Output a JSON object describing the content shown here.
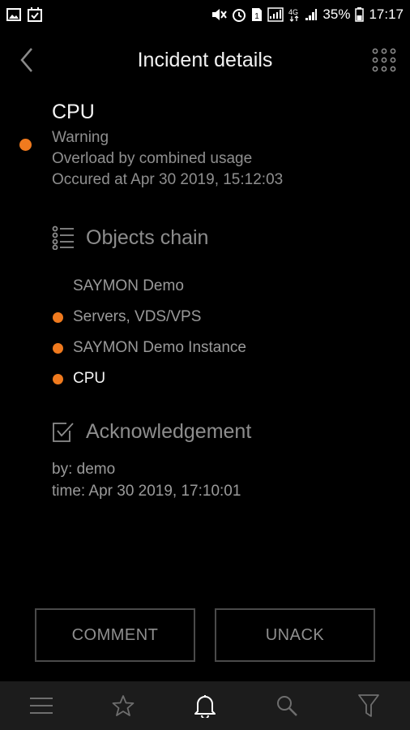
{
  "statusbar": {
    "battery": "35%",
    "time": "17:17",
    "sim_slot": "1",
    "network": "4G"
  },
  "appbar": {
    "title": "Incident details"
  },
  "incident": {
    "object": "CPU",
    "severity": "Warning",
    "description": "Overload by combined usage",
    "occurred": "Occured at Apr 30 2019, 15:12:03",
    "status_color": "#f07a1e"
  },
  "objects_chain": {
    "heading": "Objects chain",
    "items": [
      {
        "label": "SAYMON Demo",
        "has_dot": false
      },
      {
        "label": "Servers, VDS/VPS",
        "has_dot": true
      },
      {
        "label": "SAYMON Demo Instance",
        "has_dot": true
      },
      {
        "label": "CPU",
        "has_dot": true
      }
    ]
  },
  "acknowledgement": {
    "heading": "Acknowledgement",
    "by": "by: demo",
    "time": "time: Apr 30 2019, 17:10:01"
  },
  "actions": {
    "comment_label": "COMMENT",
    "unack_label": "UNACK"
  },
  "bottom_nav": {
    "items": [
      "menu-icon",
      "star-icon",
      "bell-icon",
      "search-icon",
      "filter-icon"
    ],
    "active": "bell-icon"
  },
  "colors": {
    "accent": "#f07a1e",
    "background": "#000000",
    "nav_background": "#1c1c1c"
  }
}
